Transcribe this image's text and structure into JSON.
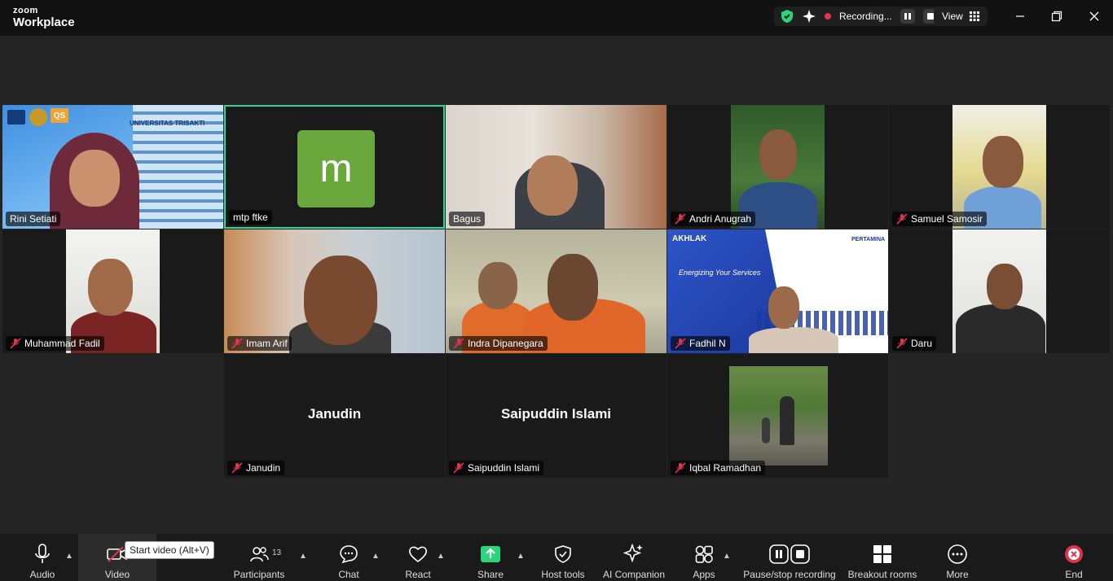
{
  "app": {
    "brand_top": "zoom",
    "brand_bottom": "Workplace"
  },
  "status": {
    "recording": "Recording...",
    "view": "View"
  },
  "participants": [
    {
      "name": "Rini Setiati",
      "muted": false
    },
    {
      "name": "mtp ftke",
      "muted": false,
      "avatar_letter": "m"
    },
    {
      "name": "Bagus",
      "muted": false
    },
    {
      "name": "Andri Anugrah",
      "muted": true
    },
    {
      "name": "Samuel Samosir",
      "muted": true
    },
    {
      "name": "Muhammad Fadil",
      "muted": true
    },
    {
      "name": "Imam Arif",
      "muted": true
    },
    {
      "name": "Indra Dipanegara",
      "muted": true
    },
    {
      "name": "Fadhil N",
      "muted": true
    },
    {
      "name": "Daru",
      "muted": true
    },
    {
      "name": "Janudin",
      "muted": true,
      "big_label": "Janudin"
    },
    {
      "name": "Saipuddin Islami",
      "muted": true,
      "big_label": "Saipuddin Islami"
    },
    {
      "name": "Iqbal Ramadhan",
      "muted": true
    }
  ],
  "tile_text": {
    "rini_banner": "UNIVERSITAS TRISAKTI",
    "rini_logo": "QS",
    "fadhil_brand": "AKHLAK",
    "fadhil_company": "PERTAMINA",
    "fadhil_tagline": "Energizing Your Services"
  },
  "toolbar": {
    "audio": "Audio",
    "video": "Video",
    "participants": "Participants",
    "participants_count": "13",
    "chat": "Chat",
    "react": "React",
    "share": "Share",
    "host_tools": "Host tools",
    "ai_companion": "AI Companion",
    "apps": "Apps",
    "pause_recording": "Pause/stop recording",
    "breakout": "Breakout rooms",
    "more": "More",
    "end": "End"
  },
  "tooltip": "Start video (Alt+V)",
  "colors": {
    "active_speaker": "#2bd69f",
    "mute": "#e0334c",
    "share": "#2bd67b",
    "avatar": "#6aa83e"
  }
}
